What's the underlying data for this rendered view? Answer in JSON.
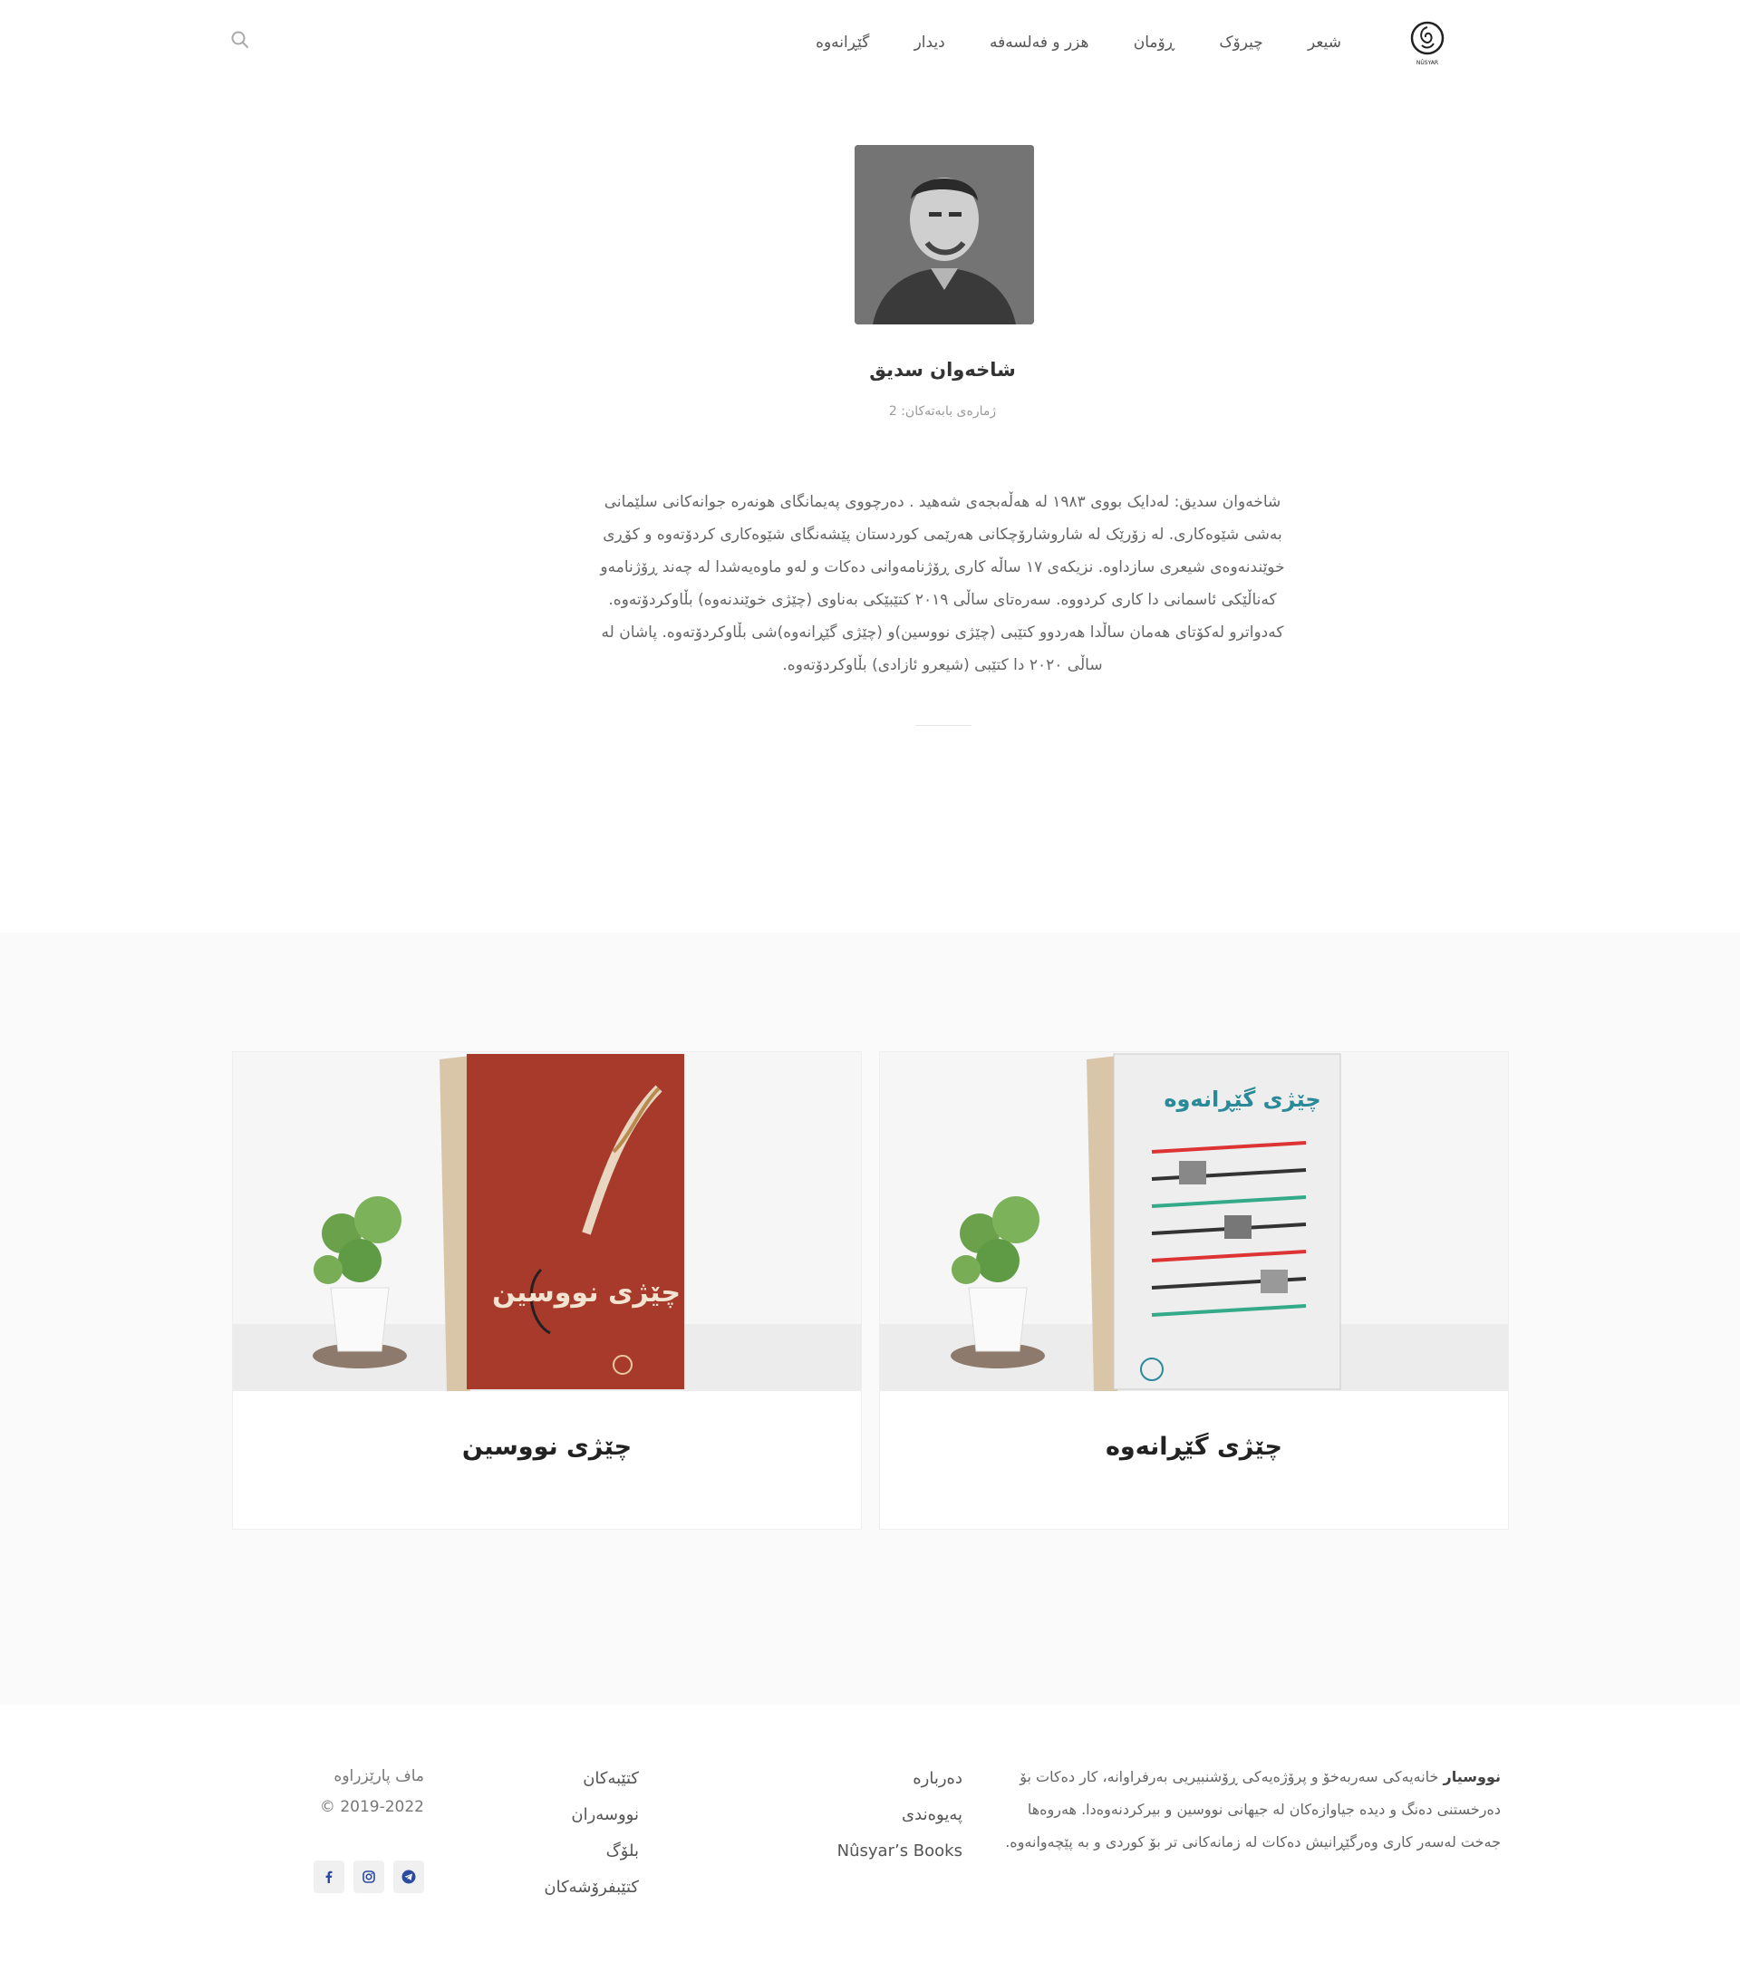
{
  "header": {
    "nav": [
      {
        "label": "شیعر"
      },
      {
        "label": "چیرۆک"
      },
      {
        "label": "ڕۆمان"
      },
      {
        "label": "هزر و فەلسەفە"
      },
      {
        "label": "دیدار"
      },
      {
        "label": "گێڕانەوە"
      }
    ],
    "logo_icon": "nusyar-logo",
    "search_icon": "search-icon"
  },
  "author": {
    "name": "شاخەوان سدیق",
    "post_count_label": "ژمارەی بابەتەکان: 2",
    "bio": "شاخەوان سدیق: لەدایک بووی ١٩٨٣ لە هەڵەبجەی شەهید . دەرچووی پەیمانگای هونەرە جوانەکانی سلێمانی بەشی شێوەکاری. لە زۆرێک لە شاروشارۆچکانی هەرێمی کوردستان پێشەنگای شێوەکاری کردۆتەوە و کۆڕی خوێندنەوەی شیعری سازداوە. نزیکەی ١٧ ساڵە کاری ڕۆژنامەوانی دەکات و لەو ماوەیەشدا لە چەند ڕۆژنامەو کەناڵێکی ئاسمانی دا کاری کردووە. سەرەتای ساڵی ٢٠١٩ کتێبێکی بەناوی (چێژی خوێندنەوە) بڵاوکردۆتەوە. کەدواترو لەکۆتای هەمان ساڵدا هەردوو کتێبی (چێژی نووسین)و (چێژی گێڕانەوە)شی بڵاوکردۆتەوە. پاشان لە ساڵی ٢٠٢٠ دا کتێبی (شیعرو ئازادی) بڵاوکردۆتەوە."
  },
  "books": [
    {
      "title": "چێژی گێڕانەوە",
      "cover_color": "#eeeeee",
      "cover_label": "چێژی گێڕانەوە"
    },
    {
      "title": "چێژی نووسین",
      "cover_color": "#a83a2c",
      "cover_label": "چێژی نووسین"
    }
  ],
  "footer": {
    "about_brand": "نووسیار",
    "about_text": " خانەیەکی سەربەخۆ و پرۆژەیەکی ڕۆشنبیریی بەرفراوانە، کار دەکات بۆ دەرخستنی دەنگ و دیدە جیاوازەکان لە جیهانی نووسین و بیرکردنەوەدا. هەروەها جەخت لەسەر کاری وەرگێڕانیش دەکات لە زمانەکانی تر بۆ کوردی و بە پێچەوانەوە.",
    "links_col1": [
      {
        "label": "دەربارە"
      },
      {
        "label": "پەیوەندی"
      },
      {
        "label": "Nûsyar’s Books"
      }
    ],
    "links_col2": [
      {
        "label": "کتێبەکان"
      },
      {
        "label": "نووسەران"
      },
      {
        "label": "بلۆگ"
      },
      {
        "label": "کتێبفرۆشەکان"
      }
    ],
    "rights": "ماف پارێزراوە",
    "copyright": "© 2019-2022",
    "social": [
      "telegram-icon",
      "instagram-icon",
      "facebook-icon"
    ]
  }
}
